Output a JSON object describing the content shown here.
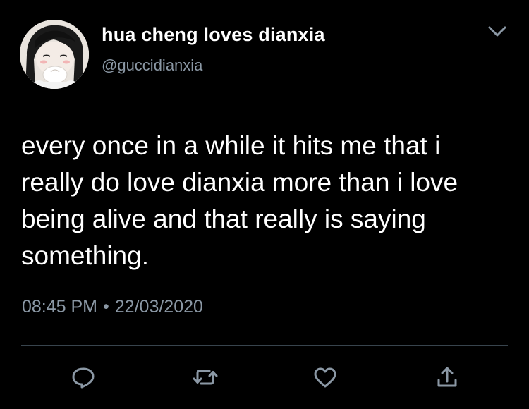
{
  "tweet": {
    "display_name": "hua cheng loves dianxia",
    "handle": "@guccidianxia",
    "body_lines": [
      "every once in a while it hits me that i",
      "really do love dianxia more than i love",
      "being alive and that really is saying",
      "something."
    ],
    "time": "08:45 PM",
    "separator": "•",
    "date": "22/03/2020"
  },
  "icons": {
    "avatar": "avatar-image",
    "menu": "chevron-down-icon",
    "reply": "reply-icon",
    "retweet": "retweet-icon",
    "like": "heart-icon",
    "share": "share-icon"
  },
  "colors": {
    "background": "#000000",
    "text_primary": "#ffffff",
    "text_secondary": "#8b98a5",
    "divider": "#38444d",
    "icon": "#8b98a5"
  }
}
